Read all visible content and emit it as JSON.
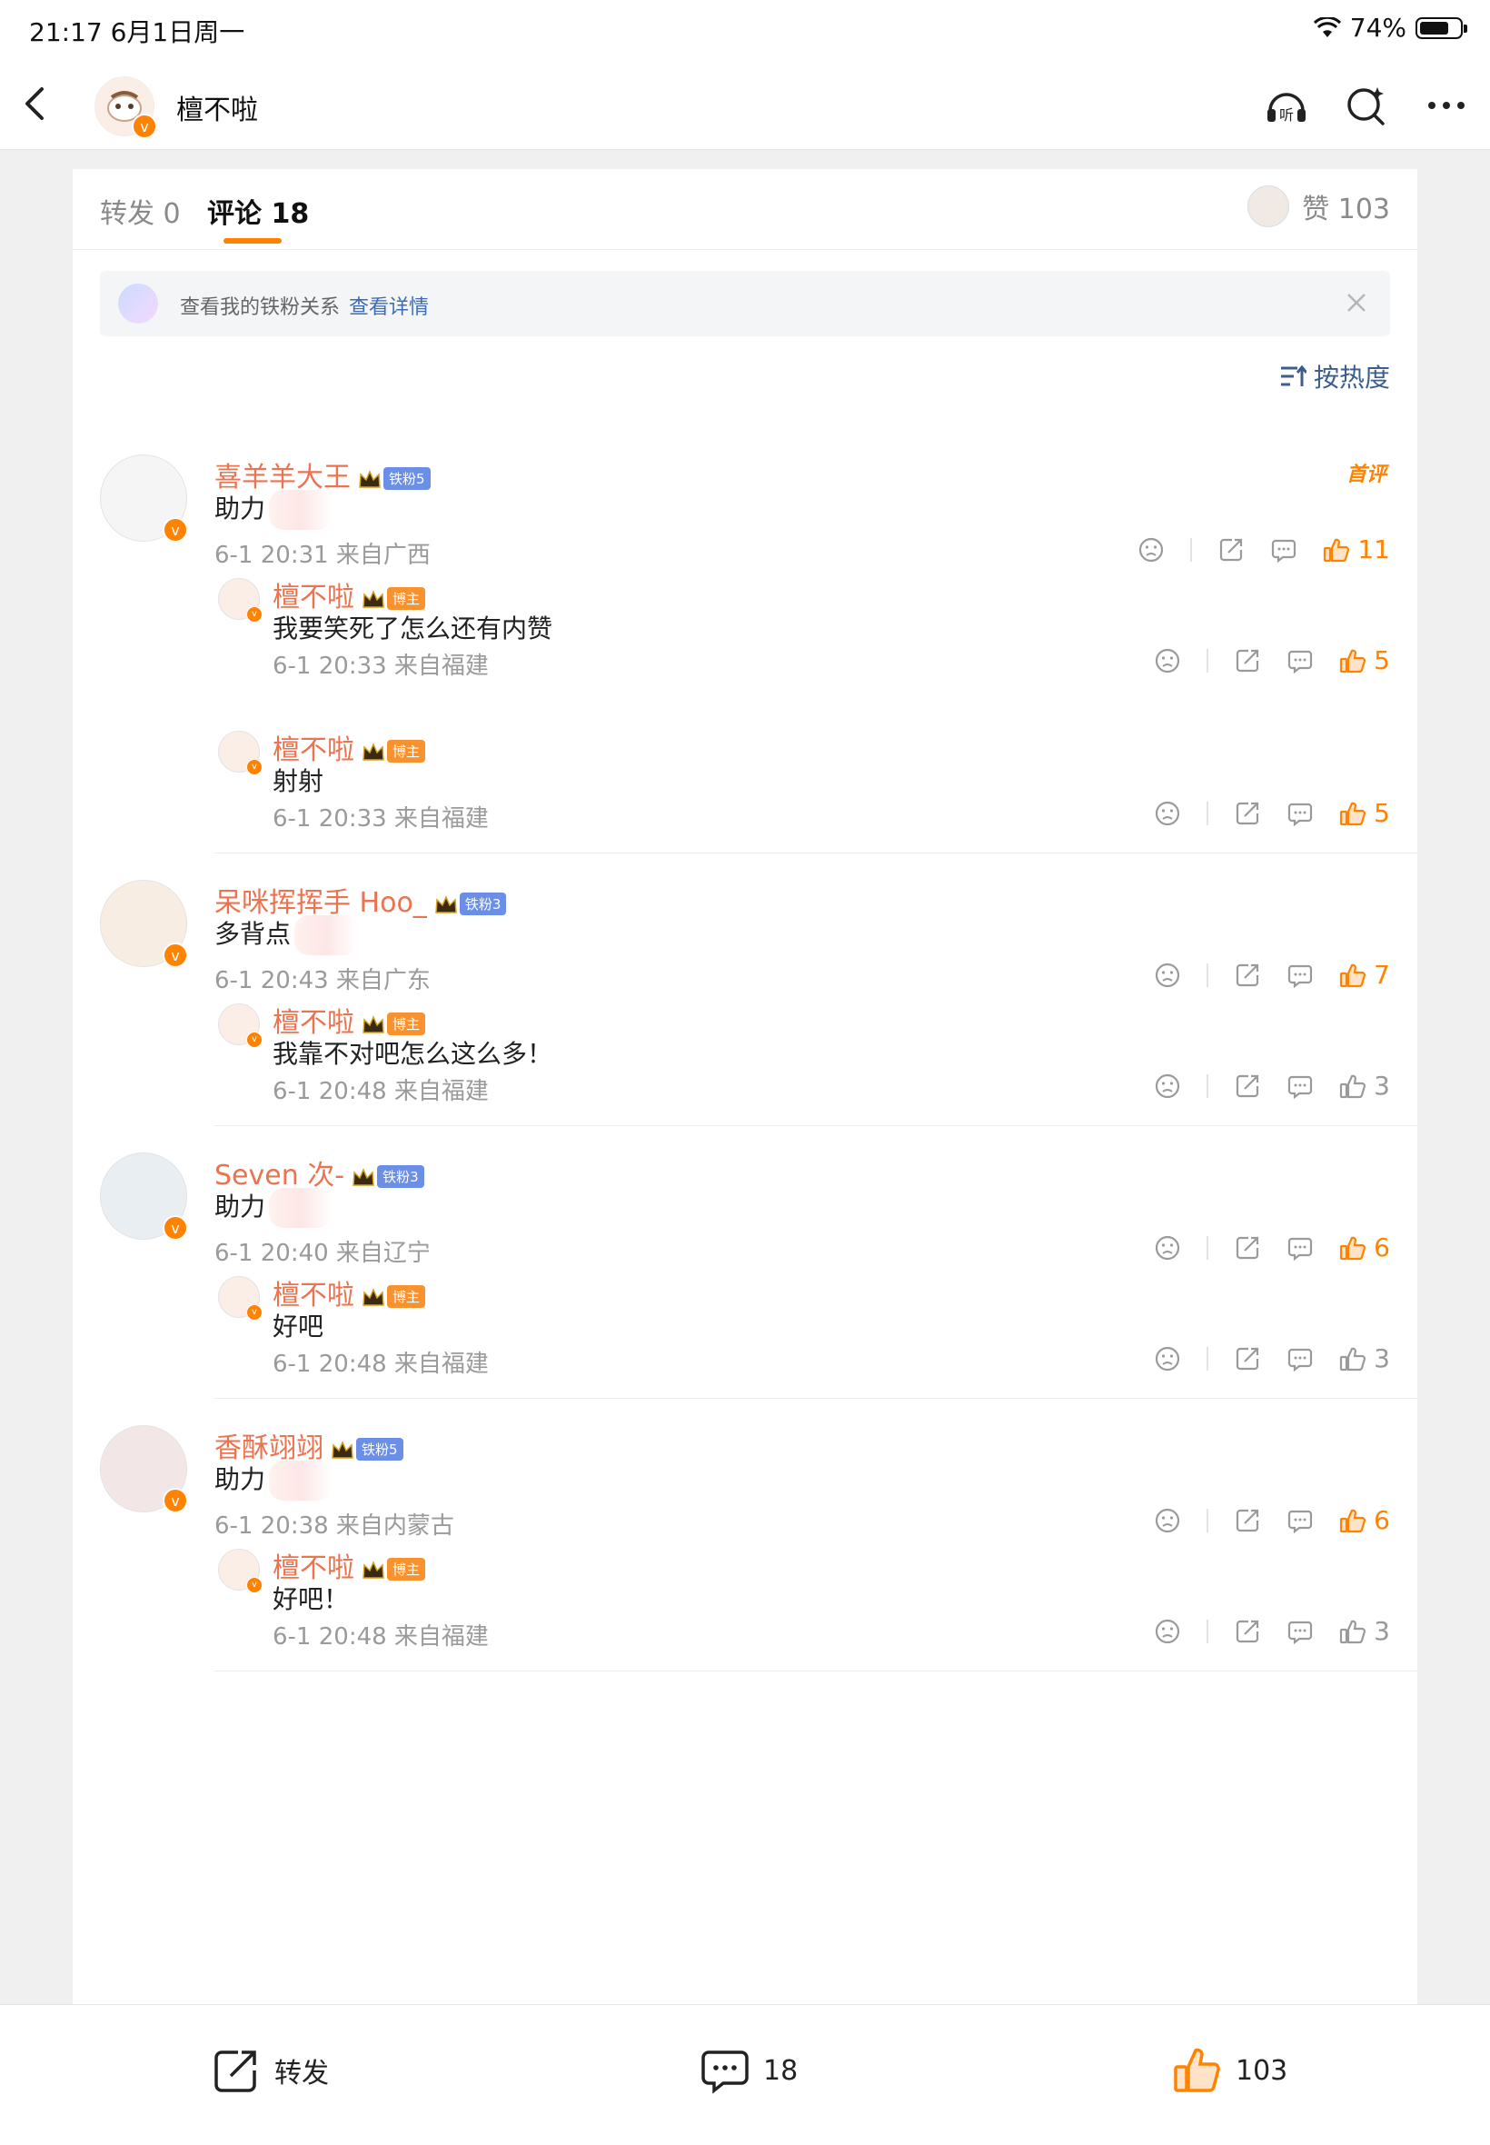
{
  "status": {
    "time": "21:17  6月1日周一",
    "battery": "74%",
    "battery_level": 0.74
  },
  "nav": {
    "title": "檀不啦"
  },
  "tabs": {
    "repost": "转发 0",
    "comment": "评论 18",
    "likes": "赞 103"
  },
  "fanbar": {
    "text": "查看我的铁粉关系",
    "link": "查看详情"
  },
  "sort": {
    "label": "按热度"
  },
  "hot_tag": "首评",
  "comments": [
    {
      "name": "喜羊羊大王",
      "badge": "铁粉5",
      "text": "助力",
      "meta": "6-1 20:31 来自广西",
      "likes": "11",
      "replies": [
        {
          "name": "檀不啦",
          "badge": "博主",
          "text": "我要笑死了怎么还有内赞",
          "meta": "6-1 20:33 来自福建",
          "likes": "5"
        },
        {
          "name": "檀不啦",
          "badge": "博主",
          "text": "射射",
          "meta": "6-1 20:33 来自福建",
          "likes": "5"
        }
      ]
    },
    {
      "name": "呆咪挥挥手 Hoo_",
      "badge": "铁粉3",
      "text": "多背点",
      "meta": "6-1 20:43 来自广东",
      "likes": "7",
      "replies": [
        {
          "name": "檀不啦",
          "badge": "博主",
          "text": "我靠不对吧怎么这么多！",
          "meta": "6-1 20:48 来自福建",
          "likes": "3"
        }
      ]
    },
    {
      "name": "Seven 次-",
      "badge": "铁粉3",
      "text": "助力",
      "meta": "6-1 20:40 来自辽宁",
      "likes": "6",
      "replies": [
        {
          "name": "檀不啦",
          "badge": "博主",
          "text": "好吧",
          "meta": "6-1 20:48 来自福建",
          "likes": "3"
        }
      ]
    },
    {
      "name": "香酥翊翊",
      "badge": "铁粉5",
      "text": "助力",
      "meta": "6-1 20:38 来自内蒙古",
      "likes": "6",
      "replies": [
        {
          "name": "檀不啦",
          "badge": "博主",
          "text": "好吧！",
          "meta": "6-1 20:48 来自福建",
          "likes": "3"
        }
      ]
    }
  ],
  "bottom": {
    "repost": "转发",
    "comments": "18",
    "likes": "103"
  },
  "colors": {
    "accent": "#ff8200",
    "name": "#eb7350",
    "link": "#3d6cb3"
  }
}
